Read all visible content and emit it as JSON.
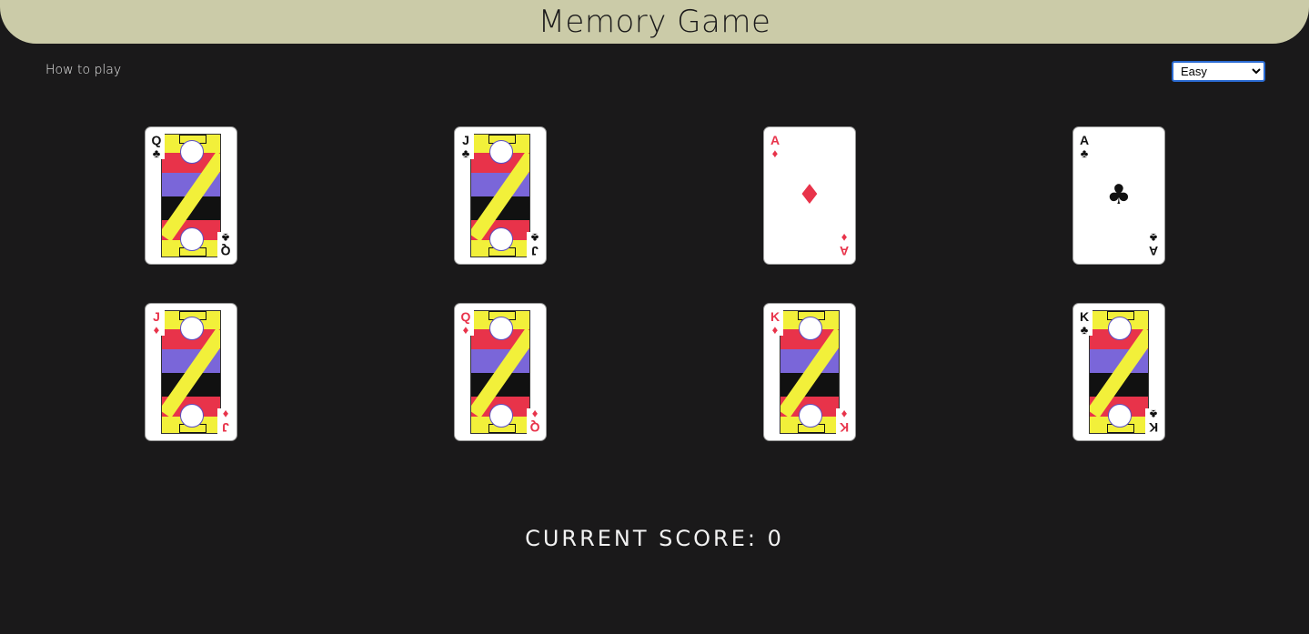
{
  "header": {
    "title": "Memory Game"
  },
  "controls": {
    "how_to_play": "How to play",
    "difficulty_selected": "Easy",
    "difficulty_options": [
      "Easy"
    ]
  },
  "cards": [
    {
      "rank": "Q",
      "suit": "♣",
      "color": "#111111",
      "type": "face"
    },
    {
      "rank": "J",
      "suit": "♣",
      "color": "#111111",
      "type": "face"
    },
    {
      "rank": "A",
      "suit": "♦",
      "color": "#e8334a",
      "type": "ace"
    },
    {
      "rank": "A",
      "suit": "♣",
      "color": "#111111",
      "type": "ace"
    },
    {
      "rank": "J",
      "suit": "♦",
      "color": "#e8334a",
      "type": "face"
    },
    {
      "rank": "Q",
      "suit": "♦",
      "color": "#e8334a",
      "type": "face"
    },
    {
      "rank": "K",
      "suit": "♦",
      "color": "#e8334a",
      "type": "face"
    },
    {
      "rank": "K",
      "suit": "♣",
      "color": "#111111",
      "type": "face"
    }
  ],
  "score": {
    "text": "CURRENT SCORE: 0"
  },
  "colors": {
    "background": "#1a191a",
    "header": "#cbcba8",
    "red_suit": "#e8334a",
    "black_suit": "#111111"
  }
}
